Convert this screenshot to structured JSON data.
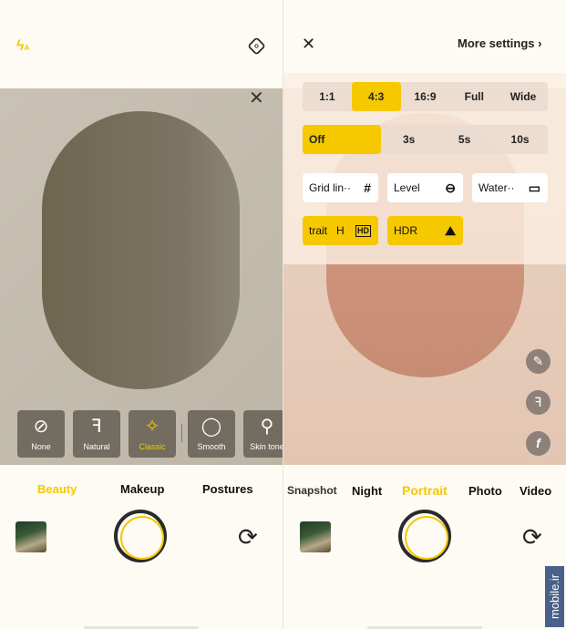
{
  "left": {
    "flash_icon": "flash-auto-icon",
    "settings_icon": "settings-hexagon-icon",
    "close_icon": "close-icon",
    "beauty_options": [
      {
        "label": "None",
        "icon": "⊘"
      },
      {
        "label": "Natural",
        "icon": "ꟻ"
      },
      {
        "label": "Classic",
        "icon": "✧"
      },
      {
        "label": "Smooth",
        "icon": "◯"
      },
      {
        "label": "Skin tone",
        "icon": "⚲"
      }
    ],
    "selected_beauty": "Classic",
    "tabs": [
      {
        "label": "Beauty",
        "active": true
      },
      {
        "label": "Makeup"
      },
      {
        "label": "Postures"
      }
    ]
  },
  "right": {
    "close_label": "✕",
    "more_settings": "More settings",
    "ratios": [
      "1:1",
      "4:3",
      "16:9",
      "Full",
      "Wide"
    ],
    "ratio_selected": "4:3",
    "timers": [
      "Off",
      "3s",
      "5s",
      "10s"
    ],
    "timer_selected": "Off",
    "toggles": [
      {
        "label": "Grid lin··",
        "icon": "#",
        "on": false
      },
      {
        "label": "Level",
        "icon": "⊖",
        "on": false
      },
      {
        "label": "Water··",
        "icon": "▭",
        "on": false
      },
      {
        "label": "trait   H",
        "icon": "HD",
        "on": true
      },
      {
        "label": "HDR",
        "icon": "⛰",
        "on": true
      }
    ],
    "modes": [
      "Snapshot",
      "Night",
      "Portrait",
      "Photo",
      "Video"
    ],
    "mode_selected": "Portrait"
  },
  "watermark": "mobile.ir",
  "accent": "#f5c800"
}
